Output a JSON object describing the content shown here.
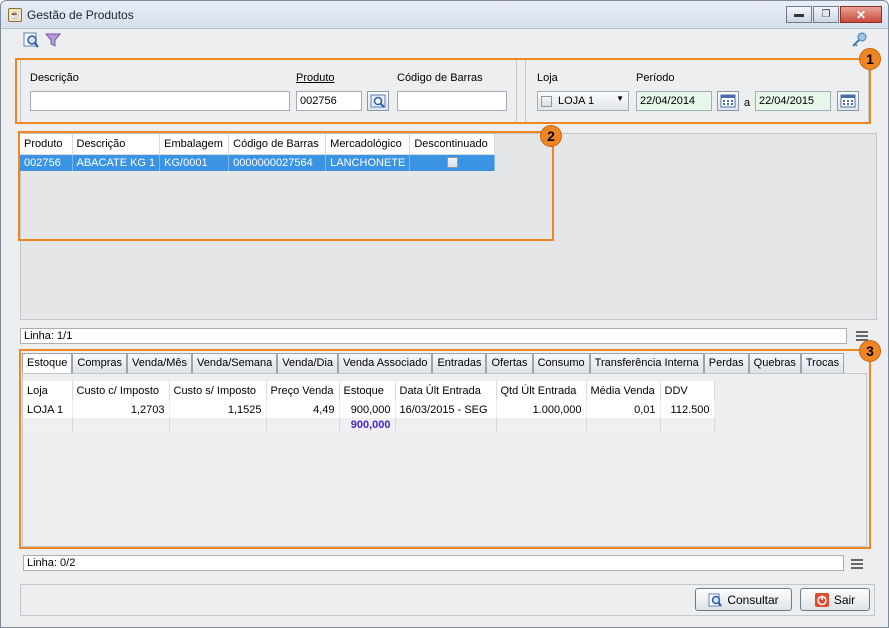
{
  "window": {
    "title": "Gestão de Produtos"
  },
  "filters": {
    "descricao_label": "Descrição",
    "descricao_value": "",
    "produto_label": "Produto",
    "produto_value": "002756",
    "codigo_barras_label": "Código de Barras",
    "codigo_barras_value": "",
    "loja_label": "Loja",
    "loja_value": "LOJA 1",
    "periodo_label": "Período",
    "periodo_from": "22/04/2014",
    "periodo_sep": "a",
    "periodo_to": "22/04/2015"
  },
  "badges": [
    "1",
    "2",
    "3"
  ],
  "products": {
    "columns": [
      "Produto",
      "Descrição",
      "Embalagem",
      "Código de Barras",
      "Mercadológico",
      "Descontinuado"
    ],
    "rows": [
      {
        "produto": "002756",
        "descricao": "ABACATE KG 1",
        "embalagem": "KG/0001",
        "codigo": "0000000027564",
        "mercadologico": "LANCHONETE"
      }
    ],
    "status": "Linha: 1/1"
  },
  "tabs": [
    "Estoque",
    "Compras",
    "Venda/Mês",
    "Venda/Semana",
    "Venda/Dia",
    "Venda Associado",
    "Entradas",
    "Ofertas",
    "Consumo",
    "Transferência Interna",
    "Perdas",
    "Quebras",
    "Trocas"
  ],
  "stock": {
    "columns": [
      "Loja",
      "Custo c/ Imposto",
      "Custo s/ Imposto",
      "Preço Venda",
      "Estoque",
      "Data Últ Entrada",
      "Qtd Últ Entrada",
      "Média Venda",
      "DDV"
    ],
    "row": {
      "loja": "LOJA 1",
      "custo_c": "1,2703",
      "custo_s": "1,1525",
      "preco": "4,49",
      "estoque": "900,000",
      "data": "16/03/2015 - SEG",
      "qtd": "1.000,000",
      "media": "0,01",
      "ddv": "112.500"
    },
    "total_estoque": "900,000",
    "status": "Linha: 0/2"
  },
  "buttons": {
    "consultar": "Consultar",
    "sair": "Sair"
  },
  "colors": {
    "accent_orange": "#f08524",
    "selection_blue": "#3b94e3",
    "total_purple": "#4a22d6"
  }
}
